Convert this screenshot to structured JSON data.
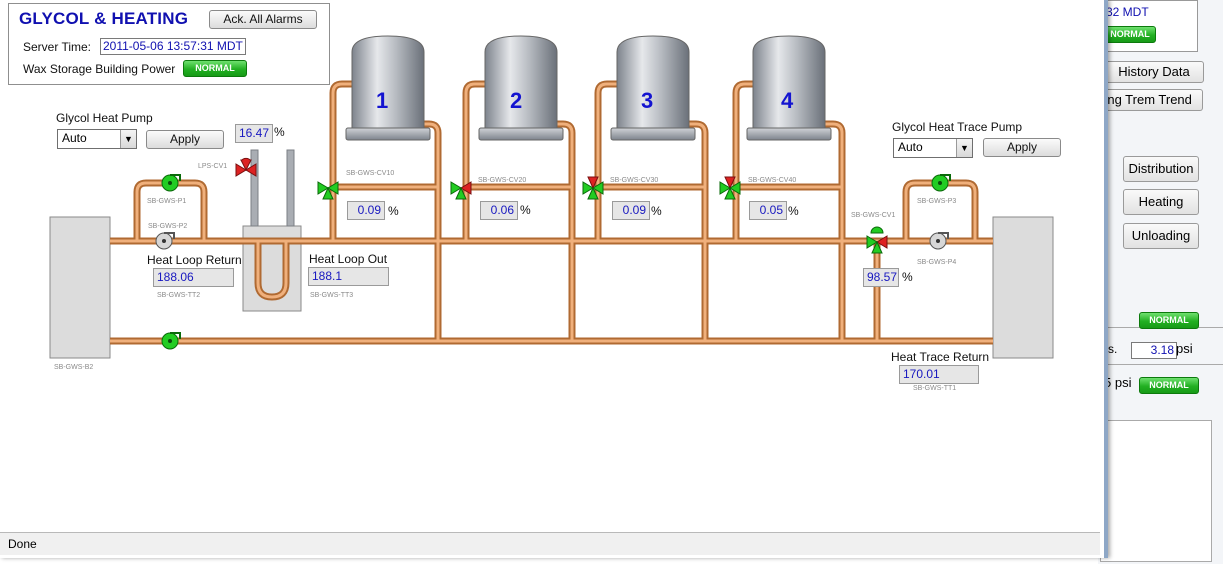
{
  "header": {
    "title": "GLYCOL & HEATING",
    "ack_button": "Ack. All Alarms",
    "server_time_label": "Server Time:",
    "server_time_value": "2011-05-06 13:57:31 MDT",
    "power_label": "Wax Storage Building Power",
    "power_status": "NORMAL"
  },
  "heat_pump": {
    "label": "Glycol Heat Pump",
    "mode": "Auto",
    "apply": "Apply",
    "lps_value": "16.47",
    "lps_unit": "%",
    "lps_tag": "LPS-CV1"
  },
  "trace_pump": {
    "label": "Glycol Heat Trace Pump",
    "mode": "Auto",
    "apply": "Apply"
  },
  "tanks": [
    {
      "number": "1",
      "valve_tag": "SB-GWS-CV10",
      "valve_value": "0.09",
      "unit": "%"
    },
    {
      "number": "2",
      "valve_tag": "SB-GWS-CV20",
      "valve_value": "0.06",
      "unit": "%"
    },
    {
      "number": "3",
      "valve_tag": "SB-GWS-CV30",
      "valve_value": "0.09",
      "unit": "%"
    },
    {
      "number": "4",
      "valve_tag": "SB-GWS-CV40",
      "valve_value": "0.05",
      "unit": "%"
    }
  ],
  "pumps": {
    "p1": "SB-GWS-P1",
    "p2": "SB-GWS-P2",
    "p3": "SB-GWS-P3",
    "p4": "SB-GWS-P4"
  },
  "sensors": {
    "heat_loop_return_label": "Heat Loop Return",
    "heat_loop_return_value": "188.06",
    "heat_loop_return_tag": "SB-GWS-TT2",
    "heat_loop_out_label": "Heat Loop Out",
    "heat_loop_out_value": "188.1",
    "heat_loop_out_tag": "SB-GWS-TT3",
    "heat_trace_return_label": "Heat Trace Return",
    "heat_trace_return_value": "170.01",
    "heat_trace_return_tag": "SB-GWS-TT1",
    "trace_valve_tag": "SB-GWS-CV1",
    "trace_valve_value": "98.57",
    "trace_valve_unit": "%",
    "boiler_tag": "SB-GWS-B2"
  },
  "status_bar": "Done",
  "background_app": {
    "time_fragment": "32 MDT",
    "normal_top": "NORMAL",
    "history_data": "History Data",
    "trend": "ong Trem Trend",
    "distribution": "Distribution",
    "heating": "Heating",
    "unloading": "Unloading",
    "normal_mid": "NORMAL",
    "pressure_prefix": "s.",
    "pressure_value": "3.18",
    "pressure_unit": "psi",
    "pressure2_fragment": "5 psi",
    "normal_bottom": "NORMAL"
  },
  "colors": {
    "pipe": "#d98c4c",
    "pump_active": "#22cc22",
    "valve_closed": "#dd2222",
    "title": "#1010b0"
  }
}
